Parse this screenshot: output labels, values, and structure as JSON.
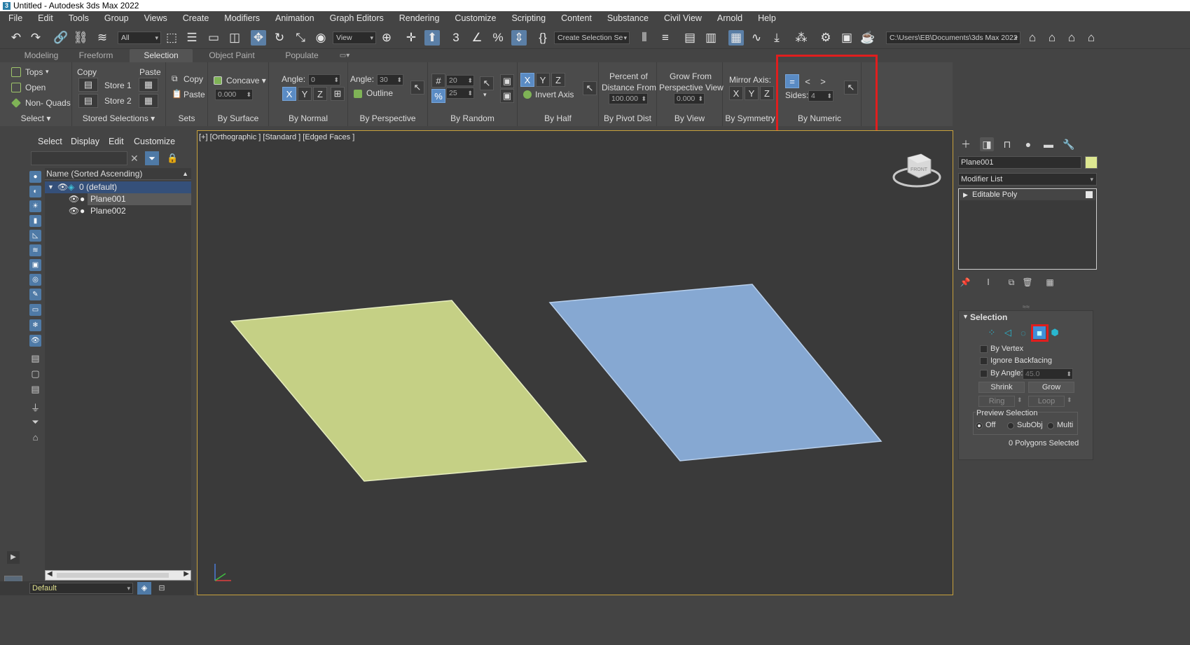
{
  "window": {
    "title": "Untitled - Autodesk 3ds Max 2022",
    "app_icon": "3"
  },
  "menu": [
    "File",
    "Edit",
    "Tools",
    "Group",
    "Views",
    "Create",
    "Modifiers",
    "Animation",
    "Graph Editors",
    "Rendering",
    "Customize",
    "Scripting",
    "Content",
    "Substance",
    "Civil View",
    "Arnold",
    "Help"
  ],
  "toolbar": {
    "filter_value": "All",
    "ref_coord_value": "View",
    "selection_set_value": "Create Selection Se",
    "path_value": "C:\\Users\\EB\\Documents\\3ds Max 2022"
  },
  "ribbon_tabs": [
    "Modeling",
    "Freeform",
    "Selection",
    "Object Paint",
    "Populate"
  ],
  "ribbon": {
    "select": {
      "tops": "Tops",
      "open": "Open",
      "non_quads": "Non- Quads",
      "label": "Select"
    },
    "stored": {
      "copy": "Copy",
      "paste": "Paste",
      "store1": "Store 1",
      "store2": "Store 2",
      "label": "Stored Selections"
    },
    "sets": {
      "copy": "Copy",
      "paste": "Paste",
      "label": "Sets"
    },
    "surface": {
      "concave": "Concave",
      "value": "0.000",
      "label": "By Surface"
    },
    "normal": {
      "angle_label": "Angle:",
      "angle_value": "0",
      "label": "By Normal"
    },
    "perspective": {
      "angle_label": "Angle:",
      "angle_value": "30",
      "outline": "Outline",
      "label": "By Perspective"
    },
    "random": {
      "count_value": "20",
      "percent_value": "25",
      "label": "By Random"
    },
    "half": {
      "invert": "Invert Axis",
      "label": "By Half"
    },
    "pivot": {
      "line1": "Percent of",
      "line2": "Distance From",
      "value": "100.000",
      "label": "By Pivot Dist"
    },
    "view": {
      "line1": "Grow From",
      "line2": "Perspective View",
      "value": "0.000",
      "label": "By View"
    },
    "symmetry": {
      "mirror": "Mirror Axis:",
      "label": "By Symmetry"
    },
    "numeric": {
      "sides_label": "Sides:",
      "sides_value": "4",
      "label": "By Numeric"
    },
    "axis_x": "X",
    "axis_y": "Y",
    "axis_z": "Z"
  },
  "explorer": {
    "menu": [
      "Select",
      "Display",
      "Edit",
      "Customize"
    ],
    "column_header": "Name (Sorted Ascending)",
    "layer": "0 (default)",
    "objects": [
      "Plane001",
      "Plane002"
    ],
    "bottom_layer": "Default"
  },
  "viewport": {
    "label": "[+] [Orthographic ] [Standard ] [Edged Faces ]",
    "viewcube_face": "FRONT"
  },
  "command_panel": {
    "object_name": "Plane001",
    "modifier_list": "Modifier List",
    "stack_item": "Editable Poly",
    "selection_title": "Selection",
    "by_vertex": "By Vertex",
    "ignore_backfacing": "Ignore Backfacing",
    "by_angle": "By Angle:",
    "by_angle_value": "45.0",
    "shrink": "Shrink",
    "grow": "Grow",
    "ring": "Ring",
    "loop": "Loop",
    "preview_selection": "Preview Selection",
    "off": "Off",
    "subobj": "SubObj",
    "multi": "Multi",
    "status": "0 Polygons Selected"
  },
  "colors": {
    "plane001": "#c5d085",
    "plane002": "#86a8d2",
    "highlight": "#e01e1e",
    "viewport_border": "#c8a23c"
  }
}
